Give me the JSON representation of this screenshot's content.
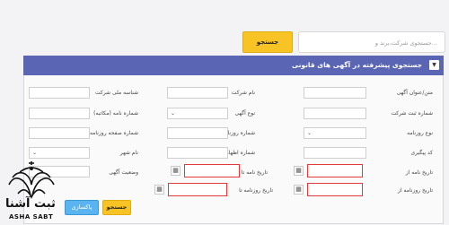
{
  "search": {
    "placeholder": "جستجوی شرکت،برند و...",
    "button_label": "جستجو"
  },
  "panel": {
    "title": "جستجوی پیشرفته در آگهی های قانونی"
  },
  "fields": {
    "title": "متن/عنوان آگهی",
    "company_name": "نام شرکت",
    "national_id": "شناسه ملی شرکت",
    "reg_no": "شماره ثبت شرکت",
    "ad_type": "نوع آگهی",
    "letter_no": "شماره نامه (مکاتبه)",
    "newspaper_type": "نوع روزنامه",
    "newspaper_no": "شماره روزنامه",
    "newspaper_page": "شماره صفحه روزنامه",
    "tracking_code": "کد پیگیری",
    "declaration_no": "شماره اظهارنامه",
    "city": "نام شهر",
    "letter_date_from": "تاریخ نامه از",
    "letter_date_to": "تاریخ نامه تا",
    "ad_status": "وضعیت آگهی",
    "newspaper_date_from": "تاریخ روزنامه از",
    "newspaper_date_to": "تاریخ روزنامه تا"
  },
  "actions": {
    "search_label": "جستجو",
    "clear_label": "پاکسازی"
  },
  "watermark": {
    "brand_fa": "ثبت آشنا",
    "brand_en": "ASHA SABT"
  },
  "icons": {
    "caret": "caret-down-icon",
    "calendar": "calendar-icon"
  },
  "colors": {
    "header": "#5a66b4",
    "accent": "#f7c325",
    "clear": "#5ab4f0",
    "error_border": "#e23a3a"
  }
}
